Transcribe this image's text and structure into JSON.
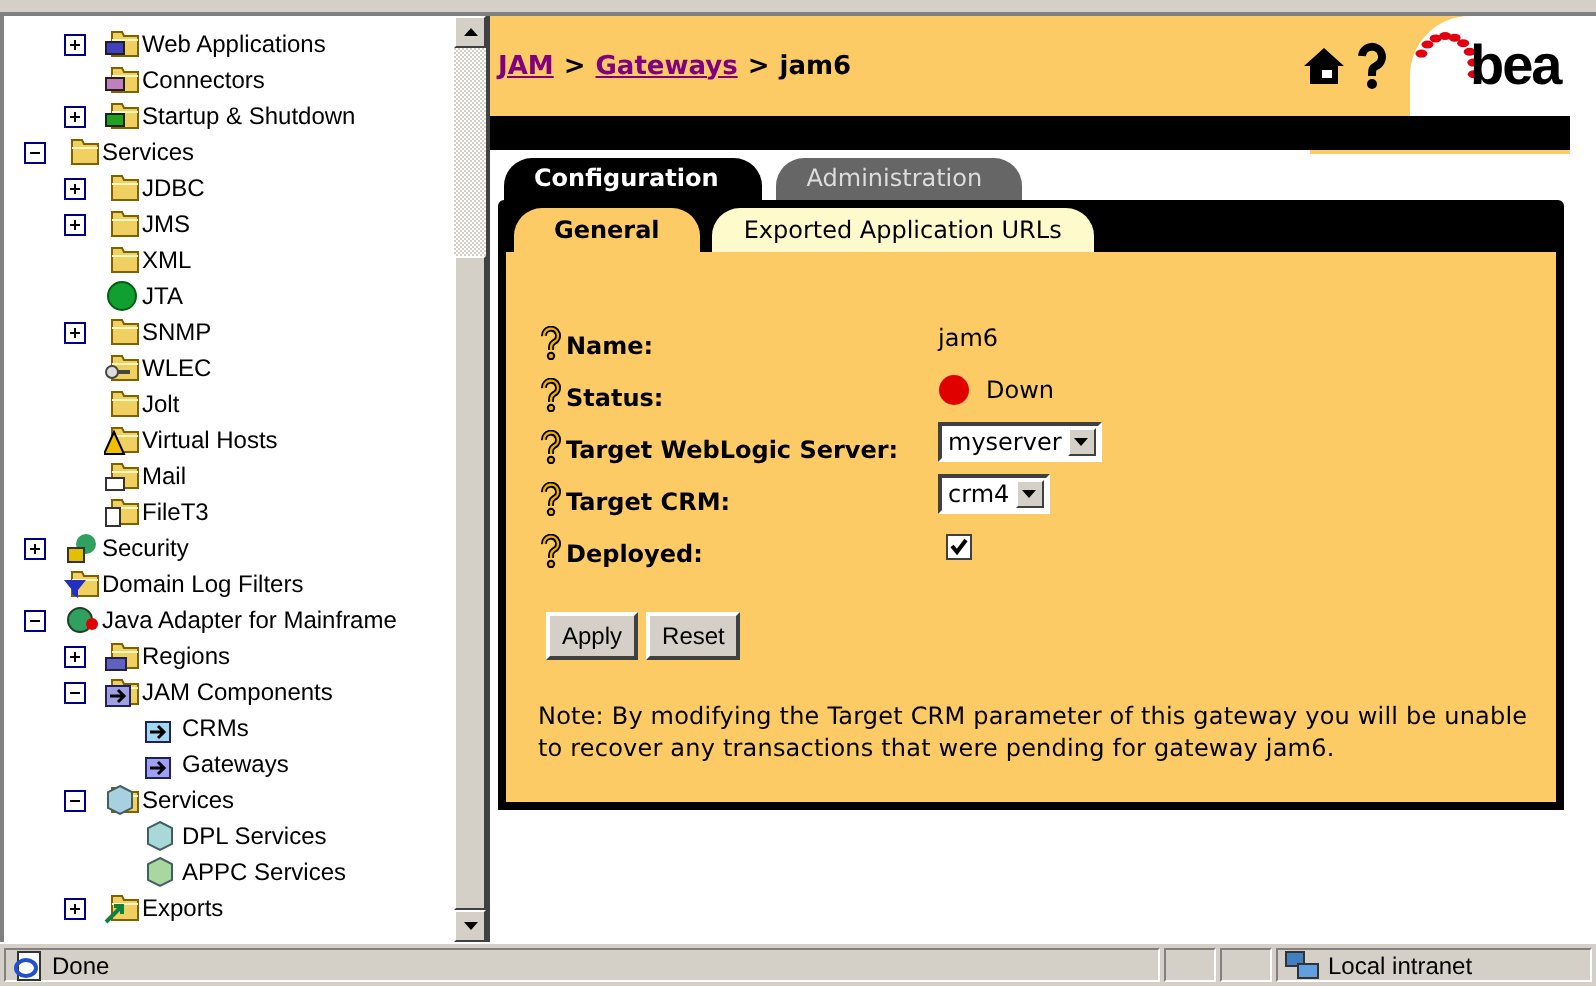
{
  "tree": {
    "upper_items": [
      {
        "label": "Web Applications",
        "kind": "component-folder",
        "color": "#4040c0",
        "expanded": false
      },
      {
        "label": "Connectors",
        "kind": "component-folder",
        "color": "#c080c0"
      },
      {
        "label": "Startup & Shutdown",
        "kind": "component-folder",
        "color": "#20a020",
        "expanded": false
      }
    ],
    "items": [
      {
        "label": "Services",
        "kind": "folder",
        "expanded": true,
        "children": [
          {
            "label": "JDBC",
            "kind": "folder",
            "expanded": false
          },
          {
            "label": "JMS",
            "kind": "folder",
            "expanded": false
          },
          {
            "label": "XML",
            "kind": "folder"
          },
          {
            "label": "JTA",
            "kind": "ball"
          },
          {
            "label": "SNMP",
            "kind": "folder",
            "expanded": false
          },
          {
            "label": "WLEC",
            "kind": "key-folder"
          },
          {
            "label": "Jolt",
            "kind": "folder"
          },
          {
            "label": "Virtual Hosts",
            "kind": "warning-folder"
          },
          {
            "label": "Mail",
            "kind": "mail-folder"
          },
          {
            "label": "FileT3",
            "kind": "doc-folder"
          }
        ]
      },
      {
        "label": "Security",
        "kind": "lock-globe",
        "expanded": false
      },
      {
        "label": "Domain Log Filters",
        "kind": "filter-folder"
      },
      {
        "label": "Java Adapter for Mainframe",
        "kind": "globe",
        "expanded": true,
        "children": [
          {
            "label": "Regions",
            "kind": "building-folder",
            "expanded": false
          },
          {
            "label": "JAM Components",
            "kind": "arrow-folder",
            "expanded": true,
            "children": [
              {
                "label": "CRMs",
                "kind": "arrow-box",
                "color": "#a0d8f0"
              },
              {
                "label": "Gateways",
                "kind": "arrow-box",
                "color": "#a0a0f0"
              }
            ]
          },
          {
            "label": "Services",
            "kind": "cube-folder",
            "expanded": true,
            "children": [
              {
                "label": "DPL Services",
                "kind": "cube",
                "color": "#a8d8d8"
              },
              {
                "label": "APPC Services",
                "kind": "cube",
                "color": "#a8d8a0"
              }
            ]
          },
          {
            "label": "Exports",
            "kind": "export-folder",
            "expanded": false
          }
        ]
      }
    ]
  },
  "breadcrumb": [
    {
      "label": "JAM",
      "link": true
    },
    {
      "label": ">",
      "link": false
    },
    {
      "label": "Gateways",
      "link": true
    },
    {
      "label": ">",
      "link": false
    },
    {
      "label": "jam6",
      "link": false
    }
  ],
  "logo": "bea",
  "tabs": [
    {
      "label": "Configuration",
      "selected": true
    },
    {
      "label": "Administration",
      "selected": false
    }
  ],
  "subtabs": [
    {
      "label": "General",
      "selected": true
    },
    {
      "label": "Exported Application URLs",
      "selected": false
    }
  ],
  "fields": [
    {
      "label": "Name:",
      "kind": "text",
      "value": "jam6"
    },
    {
      "label": "Status:",
      "kind": "status",
      "value": "Down",
      "color": "#e00000"
    },
    {
      "label": "Target WebLogic Server:",
      "kind": "select",
      "value": "myserver"
    },
    {
      "label": "Target CRM:",
      "kind": "select",
      "value": "crm4"
    },
    {
      "label": "Deployed:",
      "kind": "checkbox",
      "checked": true
    }
  ],
  "buttons": [
    "Apply",
    "Reset"
  ],
  "note": "Note: By modifying the Target CRM parameter of this gateway you will be unable to recover any transactions that were pending for gateway jam6.",
  "status_bar": {
    "text": "Done",
    "zone": "Local intranet"
  }
}
